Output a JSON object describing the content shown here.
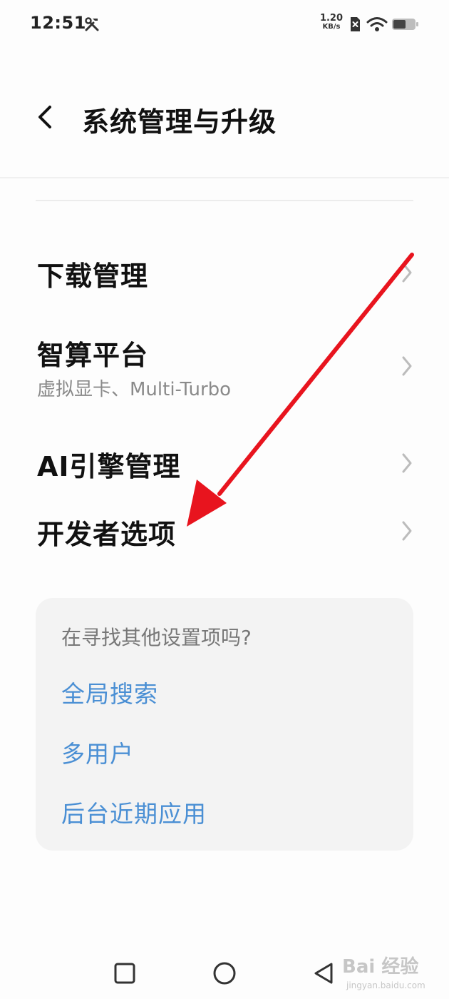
{
  "status_bar": {
    "time": "12:51",
    "net_speed_value": "1.20",
    "net_speed_unit": "KB/s",
    "icons": [
      "tools-icon",
      "sim-x-icon",
      "wifi-icon",
      "battery-icon"
    ]
  },
  "header": {
    "back_icon": "chevron-left-icon",
    "title": "系统管理与升级"
  },
  "menu": {
    "items": [
      {
        "label": "下载管理",
        "sublabel": ""
      },
      {
        "label": "智算平台",
        "sublabel": "虚拟显卡、Multi-Turbo"
      },
      {
        "label": "AI引擎管理",
        "sublabel": ""
      },
      {
        "label": "开发者选项",
        "sublabel": ""
      }
    ]
  },
  "suggestions": {
    "title": "在寻找其他设置项吗?",
    "links": [
      "全局搜索",
      "多用户",
      "后台近期应用"
    ]
  },
  "nav_bar": {
    "icons": [
      "recents-square-icon",
      "home-circle-icon",
      "back-triangle-icon"
    ]
  },
  "watermark": {
    "brand": "Bai 经验",
    "url": "jingyan.baidu.com"
  },
  "colors": {
    "link": "#4a8fd4",
    "arrow": "#e8141e",
    "card_bg": "#f3f3f3",
    "secondary_text": "#8a8a8a"
  }
}
